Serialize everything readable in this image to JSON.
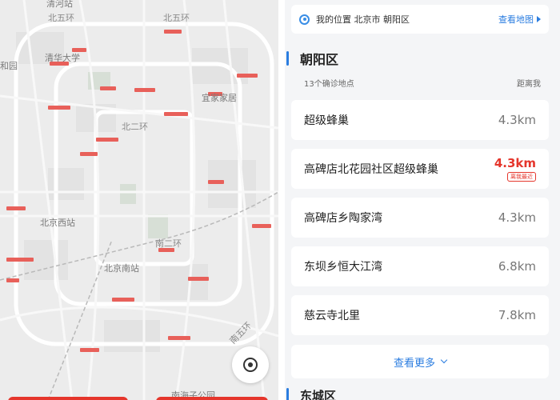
{
  "map": {
    "labels": {
      "qinghe": "清河站",
      "north5_left": "北五环",
      "north5_right": "北五环",
      "yuanmingyuan": "和园",
      "tsinghua": "清华大学",
      "yijia": "宜家家居",
      "north2": "北二环",
      "beijing_west": "北京西站",
      "south2": "南二环",
      "beijing_south": "北京南站",
      "south5": "南五环",
      "nanhaizi": "南海子公园"
    },
    "locate_icon": "locate-icon"
  },
  "location_bar": {
    "icon": "location-pin-icon",
    "text": "我的位置 北京市 朝阳区",
    "link": "查看地图"
  },
  "section": {
    "title": "朝阳区",
    "count_label": "13个确诊地点",
    "distance_label": "距离我"
  },
  "items": [
    {
      "name": "超级蜂巢",
      "distance": "4.3km"
    },
    {
      "name": "高碑店北花园社区超级蜂巢",
      "distance": "4.3km",
      "badge": "离我最近"
    },
    {
      "name": "高碑店乡陶家湾",
      "distance": "4.3km"
    },
    {
      "name": "东坝乡恒大江湾",
      "distance": "6.8km"
    },
    {
      "name": "慈云寺北里",
      "distance": "7.8km"
    }
  ],
  "more_button": "查看更多",
  "next_section": {
    "title": "东城区"
  },
  "colors": {
    "accent": "#2b7de0",
    "alert": "#e5362c",
    "map_bg": "#ececec"
  }
}
